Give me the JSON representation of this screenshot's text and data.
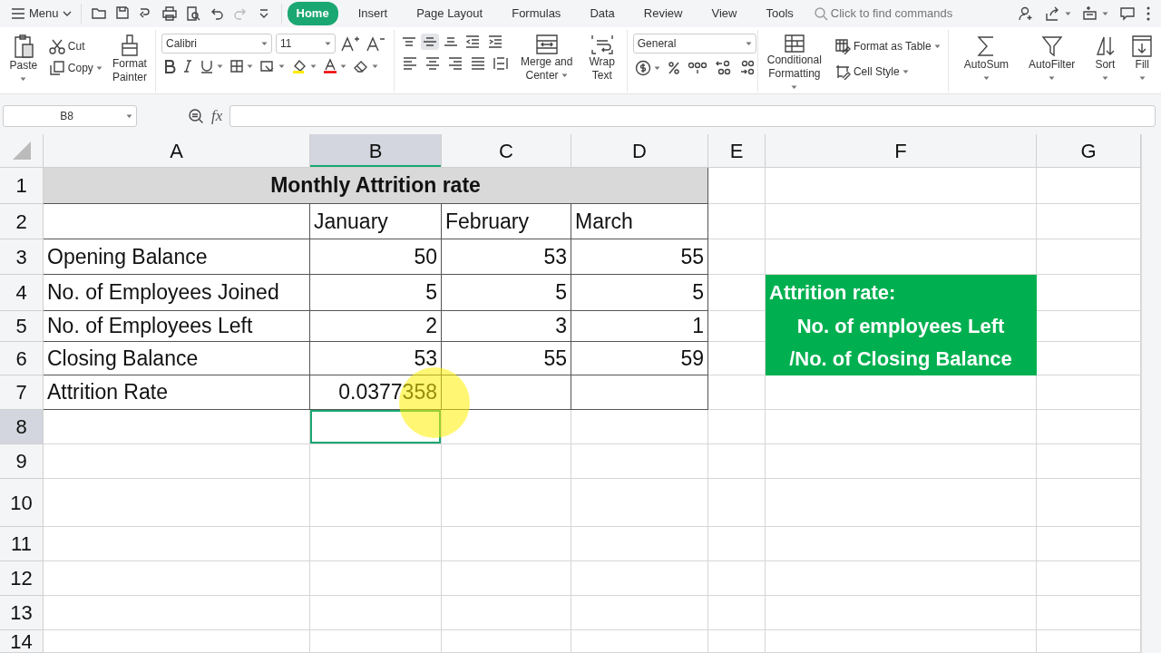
{
  "menu_bar": {
    "menu": "Menu",
    "tabs": [
      {
        "label": "Home",
        "selected": true
      },
      {
        "label": "Insert",
        "selected": false
      },
      {
        "label": "Page Layout",
        "selected": false
      },
      {
        "label": "Formulas",
        "selected": false
      },
      {
        "label": "Data",
        "selected": false
      },
      {
        "label": "Review",
        "selected": false
      },
      {
        "label": "View",
        "selected": false
      },
      {
        "label": "Tools",
        "selected": false
      }
    ],
    "search": {
      "placeholder": "Click to find commands"
    }
  },
  "ribbon": {
    "paste": "Paste",
    "cut": "Cut",
    "copy": "Copy",
    "format_painter": "Format Painter",
    "font": "Calibri",
    "font_size": "11",
    "alignment": {
      "top": false,
      "middle": true,
      "bottom": false
    },
    "merge_center": "Merge and Center",
    "wrap_text": "Wrap Text",
    "number_format": "General",
    "conditional_formatting": "Conditional Formatting",
    "format_as_table": "Format as Table",
    "cell_style": "Cell Style",
    "autosum": "AutoSum",
    "autofilter": "AutoFilter",
    "sort": "Sort",
    "fill": "Fill"
  },
  "formula_bar": {
    "name_box": "B8",
    "function_label": "fx"
  },
  "sheet": {
    "columns": [
      {
        "label": "A",
        "selected": false
      },
      {
        "label": "B",
        "selected": true
      },
      {
        "label": "C",
        "selected": false
      },
      {
        "label": "D",
        "selected": false
      },
      {
        "label": "E",
        "selected": false
      },
      {
        "label": "F",
        "selected": false
      },
      {
        "label": "G",
        "selected": false
      }
    ],
    "rows": [
      {
        "label": "1",
        "selected": false,
        "cells": {
          "A": {
            "kind": "title",
            "text": "Monthly Attrition rate"
          }
        }
      },
      {
        "label": "2",
        "selected": false,
        "cells": {
          "B": {
            "text": "January"
          },
          "C": {
            "text": "February"
          },
          "D": {
            "text": "March"
          }
        }
      },
      {
        "label": "3",
        "selected": false,
        "cells": {
          "A": {
            "text": "Opening Balance"
          },
          "B": {
            "kind": "number",
            "text": "50"
          },
          "C": {
            "kind": "number",
            "text": "53"
          },
          "D": {
            "kind": "number",
            "text": "55"
          }
        }
      },
      {
        "label": "4",
        "selected": false,
        "cells": {
          "A": {
            "text": "No. of Employees Joined"
          },
          "B": {
            "kind": "number",
            "text": "5"
          },
          "C": {
            "kind": "number",
            "text": "5"
          },
          "D": {
            "kind": "number",
            "text": "5"
          },
          "F": {
            "kind": "note",
            "text": "Attrition rate:"
          }
        }
      },
      {
        "label": "5",
        "selected": false,
        "cells": {
          "A": {
            "text": "No. of Employees Left"
          },
          "B": {
            "kind": "number",
            "text": "2"
          },
          "C": {
            "kind": "number",
            "text": "3"
          },
          "D": {
            "kind": "number",
            "text": "1"
          },
          "F": {
            "kind": "note_centered",
            "text": "No. of employees Left"
          }
        }
      },
      {
        "label": "6",
        "selected": false,
        "cells": {
          "A": {
            "text": "Closing Balance"
          },
          "B": {
            "kind": "number",
            "text": "53"
          },
          "C": {
            "kind": "number",
            "text": "55"
          },
          "D": {
            "kind": "number",
            "text": "59"
          },
          "F": {
            "kind": "note_centered",
            "text": "/No. of Closing Balance"
          }
        }
      },
      {
        "label": "7",
        "selected": false,
        "cells": {
          "A": {
            "text": "Attrition Rate"
          },
          "B": {
            "kind": "number",
            "text": "0.0377358"
          }
        }
      },
      {
        "label": "8",
        "selected": true
      },
      {
        "label": "9",
        "selected": false
      },
      {
        "label": "10",
        "selected": false
      },
      {
        "label": "11",
        "selected": false
      },
      {
        "label": "12",
        "selected": false
      },
      {
        "label": "13",
        "selected": false
      },
      {
        "label": "14",
        "selected": false
      }
    ]
  }
}
